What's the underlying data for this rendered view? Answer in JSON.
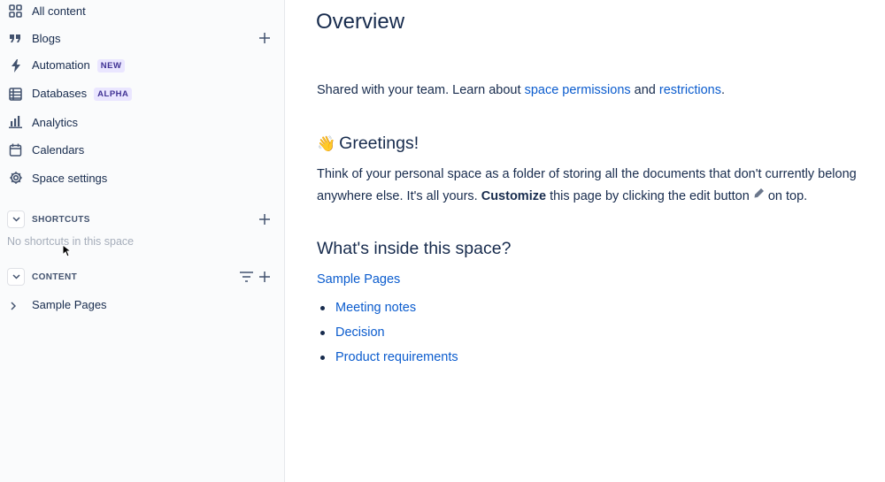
{
  "sidebar": {
    "nav": [
      {
        "label": "All content",
        "icon": "grid-icon"
      },
      {
        "label": "Blogs",
        "icon": "quote-icon"
      },
      {
        "label": "Automation",
        "icon": "lightning-icon",
        "badge": "NEW"
      },
      {
        "label": "Databases",
        "icon": "database-icon",
        "badge": "ALPHA"
      },
      {
        "label": "Analytics",
        "icon": "bar-chart-icon"
      },
      {
        "label": "Calendars",
        "icon": "calendar-icon"
      },
      {
        "label": "Space settings",
        "icon": "gear-icon"
      }
    ],
    "shortcuts": {
      "title": "SHORTCUTS",
      "empty": "No shortcuts in this space"
    },
    "content": {
      "title": "CONTENT",
      "items": [
        {
          "label": "Sample Pages"
        }
      ]
    }
  },
  "main": {
    "title": "Overview",
    "intro": {
      "prefix": "Shared with your team. Learn about ",
      "link1": "space permissions",
      "middle": " and ",
      "link2": "restrictions",
      "suffix": "."
    },
    "greetings": {
      "emoji": "👋",
      "heading": "Greetings!",
      "line1": "Think of your personal space as a folder of storing all the documents that don't currently belong",
      "line2_prefix": "anywhere else. It's all yours. ",
      "line2_bold": "Customize",
      "line2_middle": " this page by clicking the edit button ",
      "line2_suffix": " on top."
    },
    "inside": {
      "heading": "What's inside this space?",
      "parent_link": "Sample Pages",
      "items": [
        "Meeting notes",
        "Decision",
        "Product requirements"
      ]
    }
  },
  "colors": {
    "link": "#0b5cce",
    "text": "#172b4d",
    "sidebar_bg": "#fafbfc",
    "badge_bg": "#eae6ff",
    "badge_text": "#403294"
  }
}
